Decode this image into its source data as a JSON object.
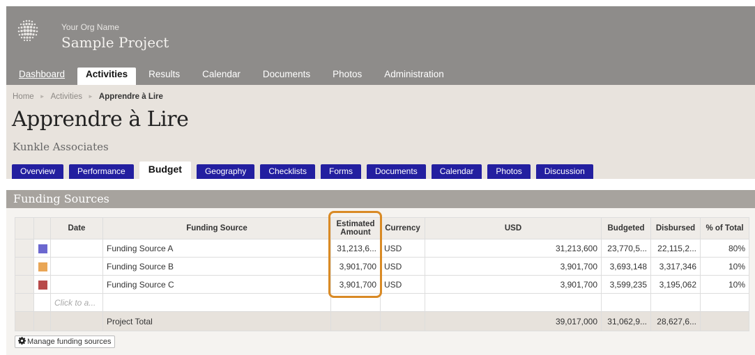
{
  "header": {
    "org_name": "Your Org Name",
    "project_name": "Sample Project"
  },
  "nav": {
    "items": [
      "Dashboard",
      "Activities",
      "Results",
      "Calendar",
      "Documents",
      "Photos",
      "Administration"
    ],
    "active": "Activities"
  },
  "breadcrumb": {
    "items": [
      "Home",
      "Activities"
    ],
    "current": "Apprendre à Lire"
  },
  "page": {
    "title": "Apprendre à Lire",
    "subtitle": "Kunkle Associates"
  },
  "tabs": {
    "items": [
      "Overview",
      "Performance",
      "Budget",
      "Geography",
      "Checklists",
      "Forms",
      "Documents",
      "Calendar",
      "Photos",
      "Discussion"
    ],
    "active": "Budget"
  },
  "section": {
    "title": "Funding Sources"
  },
  "table": {
    "columns": [
      "Date",
      "Funding Source",
      "Estimated Amount",
      "Currency",
      "USD",
      "Budgeted",
      "Disbursed",
      "% of Total"
    ],
    "rows": [
      {
        "color": "#6b67cf",
        "date": "",
        "source": "Funding Source A",
        "estimated": "31,213,6...",
        "currency": "USD",
        "usd": "31,213,600",
        "budgeted": "23,770,5...",
        "disbursed": "22,115,2...",
        "pct": "80%"
      },
      {
        "color": "#e9a656",
        "date": "",
        "source": "Funding Source B",
        "estimated": "3,901,700",
        "currency": "USD",
        "usd": "3,901,700",
        "budgeted": "3,693,148",
        "disbursed": "3,317,346",
        "pct": "10%"
      },
      {
        "color": "#b84a4a",
        "date": "",
        "source": "Funding Source C",
        "estimated": "3,901,700",
        "currency": "USD",
        "usd": "3,901,700",
        "budgeted": "3,599,235",
        "disbursed": "3,195,062",
        "pct": "10%"
      }
    ],
    "new_row_placeholder": "Click to a...",
    "total": {
      "label": "Project Total",
      "usd": "39,017,000",
      "budgeted": "31,062,9...",
      "disbursed": "28,627,6..."
    }
  },
  "buttons": {
    "manage_label": "Manage funding sources"
  },
  "colors": {
    "header_bg": "#8e8c8a",
    "band_bg": "#e8e3dd",
    "tab_bg": "#231fa0",
    "highlight": "#d98a25"
  }
}
